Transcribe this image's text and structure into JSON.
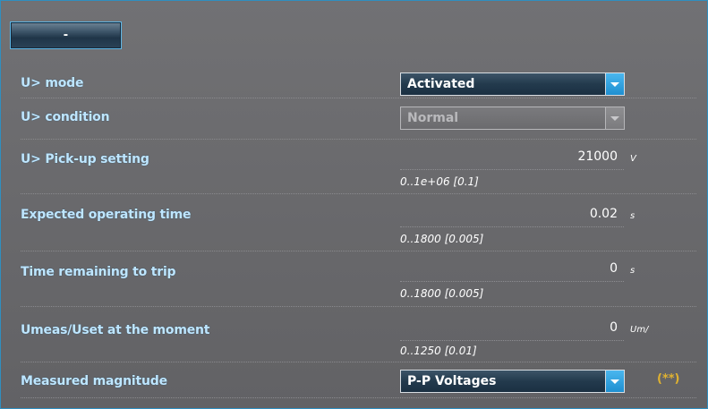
{
  "top_button": {
    "label": "-"
  },
  "rows": {
    "mode": {
      "label": "U> mode",
      "value": "Activated"
    },
    "condition": {
      "label": "U> condition",
      "value": "Normal"
    },
    "pickup": {
      "label": "U> Pick-up setting",
      "value": "21000",
      "unit": "V",
      "range": "0..1e+06 [0.1]"
    },
    "op_time": {
      "label": "Expected operating time",
      "value": "0.02",
      "unit": "s",
      "range": "0..1800 [0.005]"
    },
    "remaining": {
      "label": "Time remaining to trip",
      "value": "0",
      "unit": "s",
      "range": "0..1800 [0.005]"
    },
    "ratio": {
      "label": "Umeas/Uset at the moment",
      "value": "0",
      "unit": "Um/",
      "range": "0..1250 [0.01]"
    },
    "magnitude": {
      "label": "Measured magnitude",
      "value": "P-P Voltages",
      "note": "(**)"
    }
  },
  "colors": {
    "label": "#bfe6ff",
    "accent": "#2a9ddf",
    "note": "#e0b230"
  },
  "icons": {
    "dropdown": "chevron-down-icon"
  }
}
